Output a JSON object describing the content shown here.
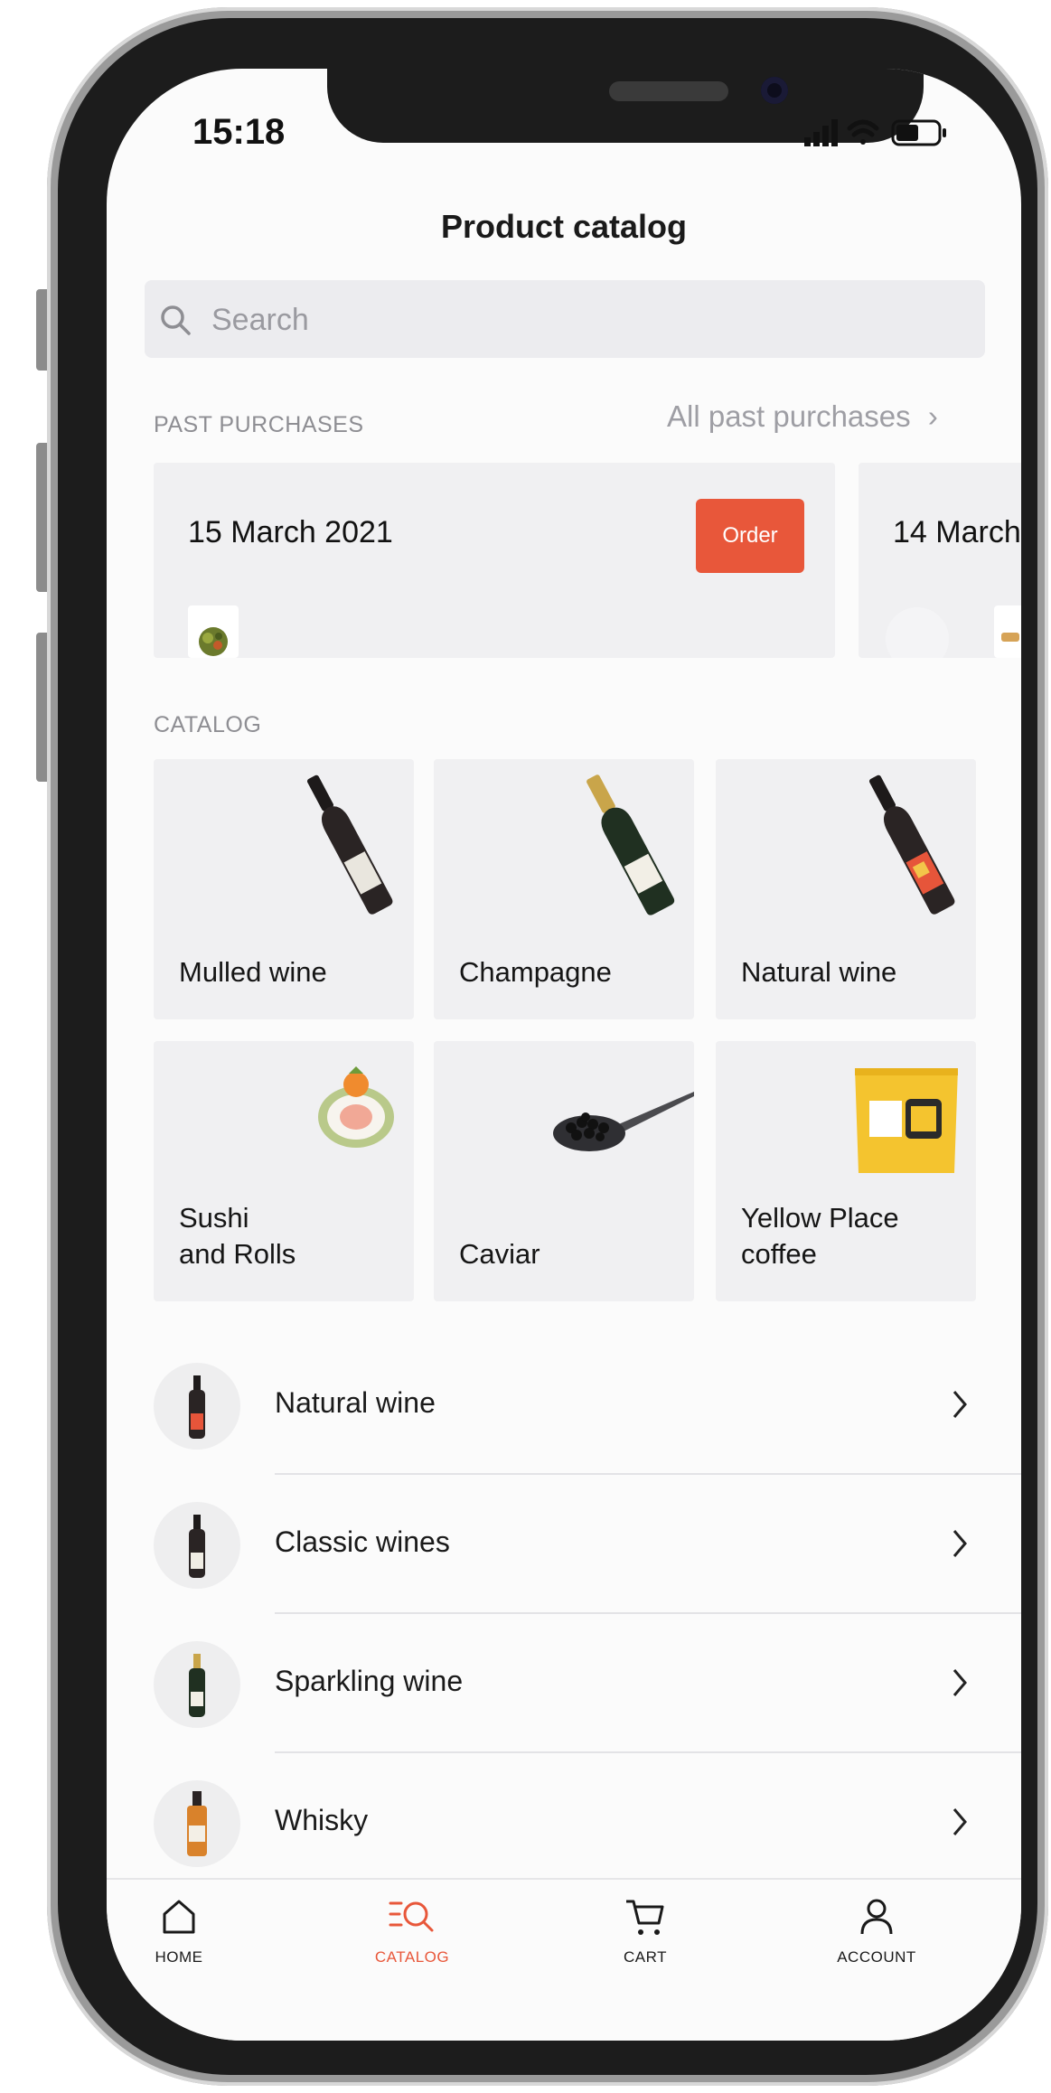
{
  "status_bar": {
    "time": "15:18"
  },
  "header": {
    "title": "Product catalog"
  },
  "search": {
    "placeholder": "Search"
  },
  "past_purchases": {
    "section_label": "PAST PURCHASES",
    "all_link": "All past purchases",
    "cards": [
      {
        "date": "15 March 2021",
        "order_label": "Order"
      },
      {
        "date": "14 March"
      }
    ]
  },
  "catalog": {
    "section_label": "CATALOG",
    "tiles": [
      {
        "name": "Mulled wine"
      },
      {
        "name": "Champagne"
      },
      {
        "name": "Natural wine"
      },
      {
        "name": "Sushi\nand Rolls"
      },
      {
        "name": "Caviar"
      },
      {
        "name": "Yellow Place\ncoffee"
      }
    ]
  },
  "category_list": [
    {
      "label": "Natural wine"
    },
    {
      "label": "Classic wines"
    },
    {
      "label": "Sparkling wine"
    },
    {
      "label": "Whisky"
    }
  ],
  "tabbar": {
    "tabs": [
      {
        "label": "HOME",
        "icon": "home-icon"
      },
      {
        "label": "CATALOG",
        "icon": "catalog-search-icon"
      },
      {
        "label": "CART",
        "icon": "cart-icon"
      },
      {
        "label": "ACCOUNT",
        "icon": "account-icon"
      }
    ],
    "active_color": "#e8573a"
  },
  "colors": {
    "accent": "#e8573a",
    "card_bg": "#f0f0f2",
    "background": "#fbfbfb"
  }
}
